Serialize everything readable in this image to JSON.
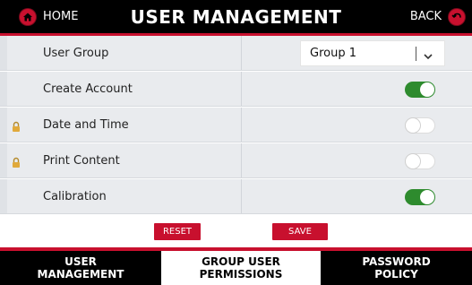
{
  "header": {
    "home_label": "HOME",
    "title": "USER MANAGEMENT",
    "back_label": "BACK"
  },
  "rows": [
    {
      "label": "User Group",
      "control": "select",
      "value": "Group 1",
      "locked": false
    },
    {
      "label": "Create Account",
      "control": "toggle",
      "on": true,
      "locked": false
    },
    {
      "label": "Date and Time",
      "control": "toggle",
      "on": false,
      "locked": true
    },
    {
      "label": "Print Content",
      "control": "toggle",
      "on": false,
      "locked": true
    },
    {
      "label": "Calibration",
      "control": "toggle",
      "on": true,
      "locked": false
    }
  ],
  "actions": {
    "reset_label": "RESET",
    "save_label": "SAVE"
  },
  "tabs": [
    {
      "line1": "USER",
      "line2": "MANAGEMENT",
      "active": false
    },
    {
      "line1": "GROUP USER",
      "line2": "PERMISSIONS",
      "active": true
    },
    {
      "line1": "PASSWORD",
      "line2": "POLICY",
      "active": false
    }
  ],
  "colors": {
    "accent_red": "#c8102e",
    "toggle_on": "#2e8b2e",
    "header_bg": "#000000",
    "row_bg": "#e9ebee"
  },
  "icons": {
    "home": "home-icon",
    "back": "back-arrow-icon",
    "lock": "lock-icon",
    "dropdown": "chevron-down-icon"
  }
}
